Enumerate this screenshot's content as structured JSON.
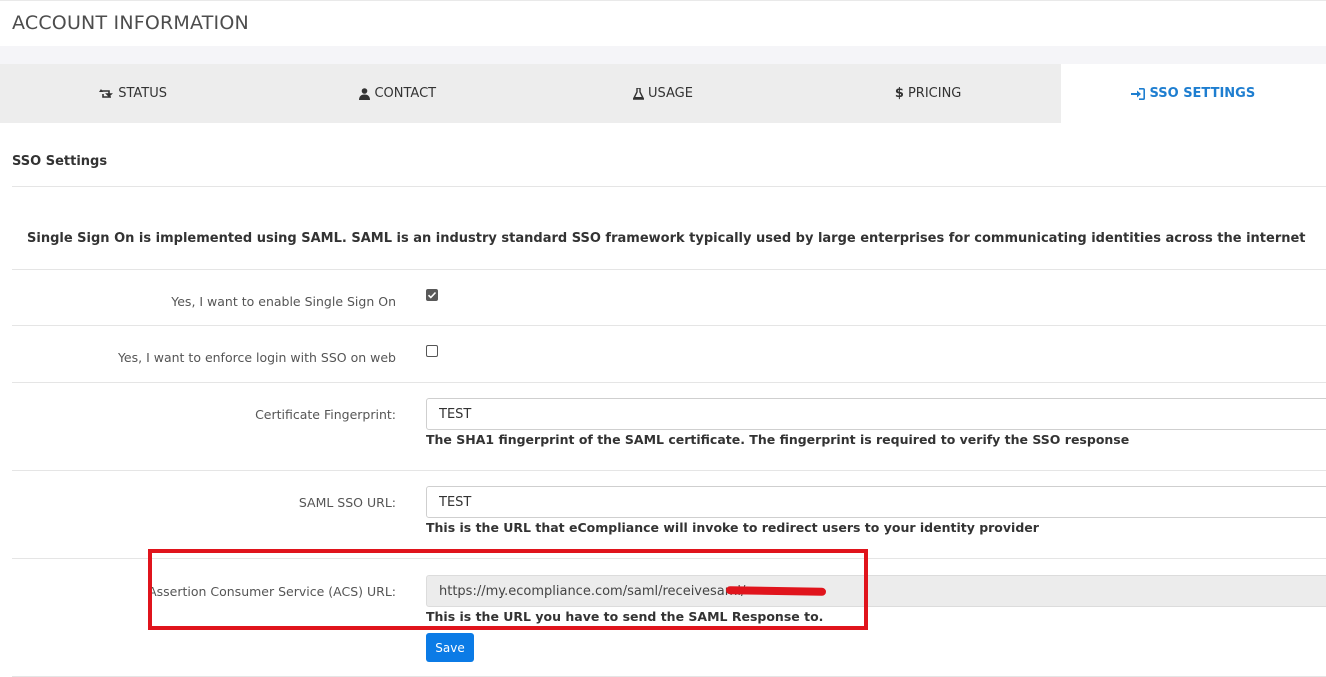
{
  "page": {
    "title": "ACCOUNT INFORMATION"
  },
  "tabs": [
    {
      "label": "STATUS",
      "icon": "retweet-icon"
    },
    {
      "label": "CONTACT",
      "icon": "user-icon"
    },
    {
      "label": "USAGE",
      "icon": "flask-icon"
    },
    {
      "label": "PRICING",
      "icon": "dollar-icon"
    },
    {
      "label": "SSO SETTINGS",
      "icon": "sign-in-icon",
      "active": true
    }
  ],
  "section": {
    "title": "SSO Settings",
    "intro": "Single Sign On is implemented using SAML. SAML is an industry standard SSO framework typically used by large enterprises for communicating identities across the internet"
  },
  "form": {
    "enable_sso": {
      "label": "Yes, I want to enable Single Sign On",
      "checked": true
    },
    "enforce_sso": {
      "label": "Yes, I want to enforce login with SSO on web",
      "checked": false
    },
    "fingerprint": {
      "label": "Certificate Fingerprint:",
      "value": "TEST",
      "help": "The SHA1 fingerprint of the SAML certificate. The fingerprint is required to verify the SSO response"
    },
    "sso_url": {
      "label": "SAML SSO URL:",
      "value": "TEST",
      "help": "This is the URL that eCompliance will invoke to redirect users to your identity provider"
    },
    "acs_url": {
      "label": "Assertion Consumer Service (ACS) URL:",
      "value": "https://my.ecompliance.com/saml/receivesaml/",
      "help": "This is the URL you have to send the SAML Response to."
    },
    "save_label": "Save"
  },
  "colors": {
    "accent": "#1e7ed0",
    "button": "#0b7be6",
    "annotation": "#e0141c"
  }
}
